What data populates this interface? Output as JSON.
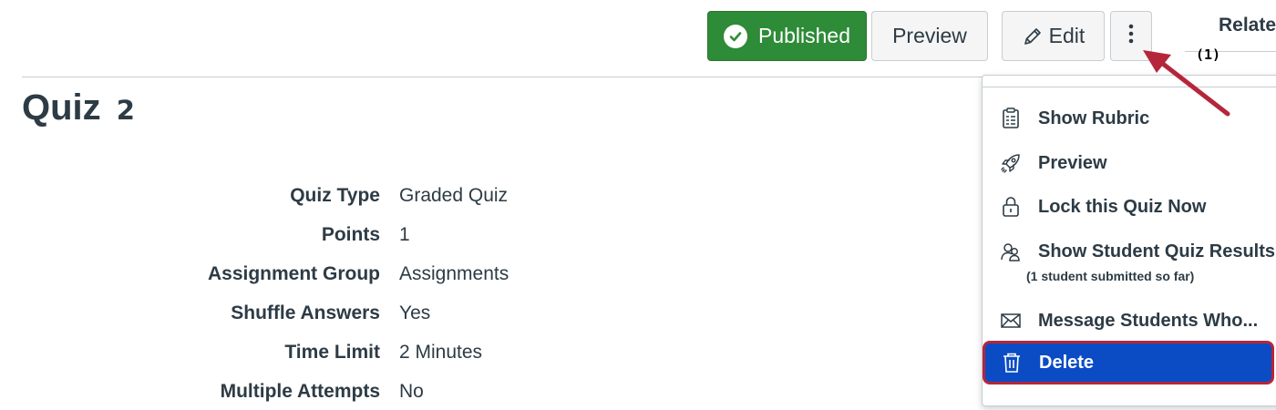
{
  "header": {
    "published_label": "Published",
    "preview_label": "Preview",
    "edit_label": "Edit",
    "related_label": "Relate",
    "callout_label": "(1)"
  },
  "quiz": {
    "title": "Quiz",
    "title_number": "2"
  },
  "details": [
    {
      "label": "Quiz Type",
      "value": "Graded Quiz"
    },
    {
      "label": "Points",
      "value": "1"
    },
    {
      "label": "Assignment Group",
      "value": "Assignments"
    },
    {
      "label": "Shuffle Answers",
      "value": "Yes"
    },
    {
      "label": "Time Limit",
      "value": "2 Minutes"
    },
    {
      "label": "Multiple Attempts",
      "value": "No"
    }
  ],
  "menu": {
    "items": [
      {
        "label": "Show Rubric",
        "icon": "rubric-icon"
      },
      {
        "label": "Preview",
        "icon": "rocket-icon"
      },
      {
        "label": "Lock this Quiz Now",
        "icon": "lock-icon"
      },
      {
        "label": "Show Student Quiz Results",
        "icon": "users-icon"
      },
      {
        "label": "Message Students Who...",
        "icon": "envelope-icon"
      }
    ],
    "results_note": "(1 student submitted so far)",
    "delete_label": "Delete"
  },
  "colors": {
    "published": "#2e8b37",
    "delete_bg": "#0b4cc4",
    "highlight_border": "#b5263a",
    "arrow": "#b5263a"
  }
}
